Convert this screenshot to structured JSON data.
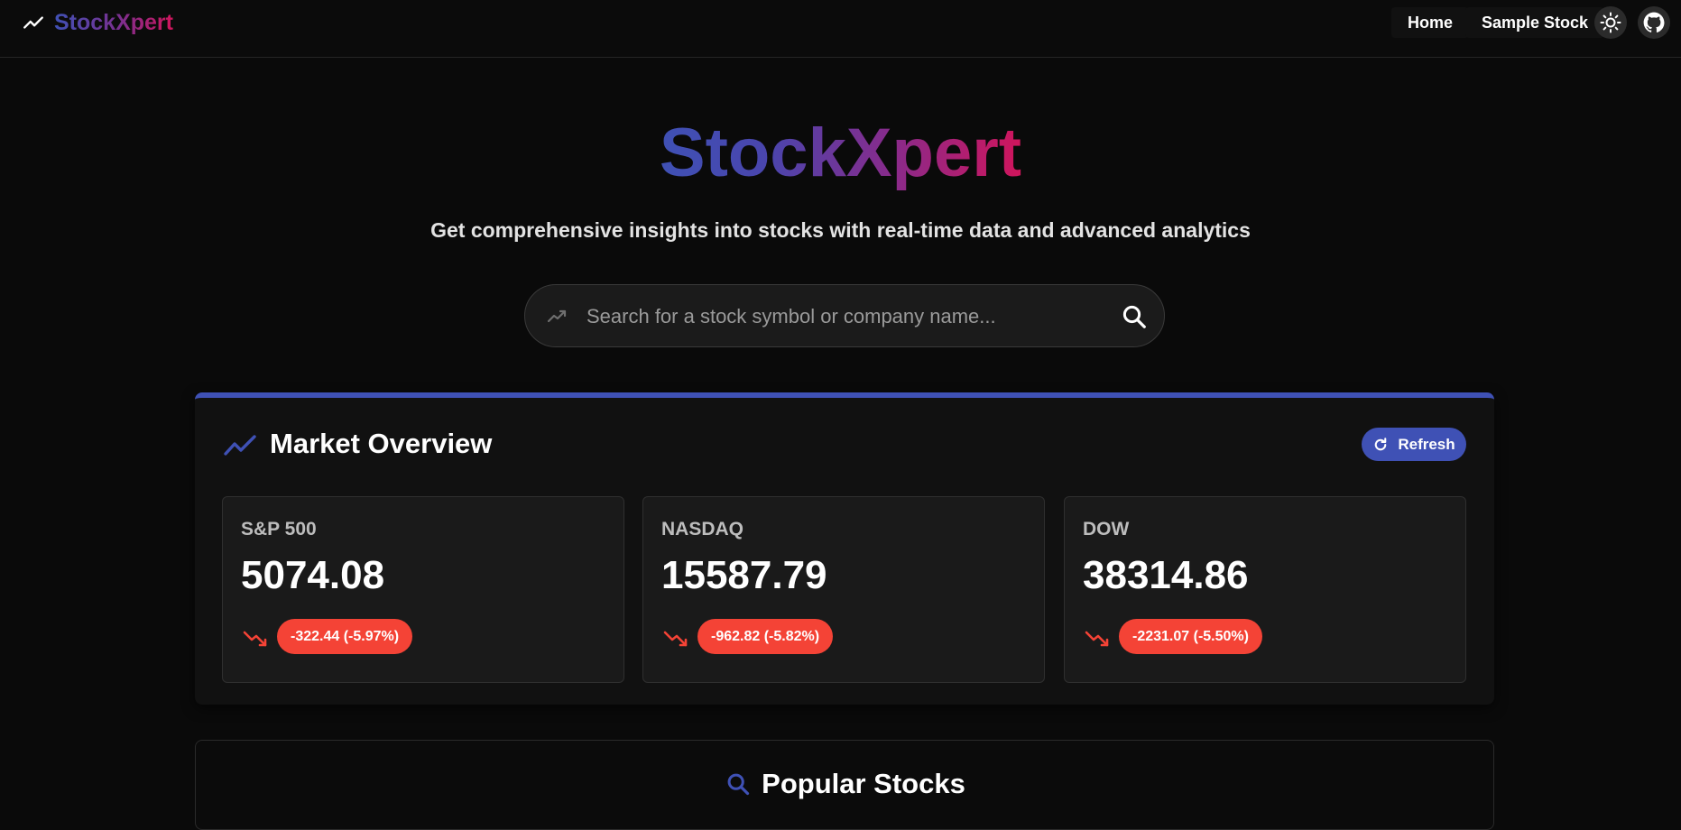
{
  "navbar": {
    "brand": "StockXpert",
    "links": [
      {
        "label": "Home"
      },
      {
        "label": "Sample Stock"
      }
    ],
    "theme_toggle_icon": "sun-icon",
    "github_icon": "github-icon"
  },
  "hero": {
    "title": "StockXpert",
    "subtitle": "Get comprehensive insights into stocks with real-time data and advanced analytics"
  },
  "search": {
    "placeholder": "Search for a stock symbol or company name...",
    "value": ""
  },
  "market_overview": {
    "title": "Market Overview",
    "refresh_label": "Refresh",
    "indices": [
      {
        "name": "S&P 500",
        "value": "5074.08",
        "change": "-322.44 (-5.97%)",
        "direction": "down"
      },
      {
        "name": "NASDAQ",
        "value": "15587.79",
        "change": "-962.82 (-5.82%)",
        "direction": "down"
      },
      {
        "name": "DOW",
        "value": "38314.86",
        "change": "-2231.07 (-5.50%)",
        "direction": "down"
      }
    ]
  },
  "popular": {
    "title": "Popular Stocks"
  },
  "colors": {
    "accent": "#3f51b5",
    "brand_gradient_end": "#d0155c",
    "negative": "#f44336",
    "background": "#0a0a0a"
  }
}
